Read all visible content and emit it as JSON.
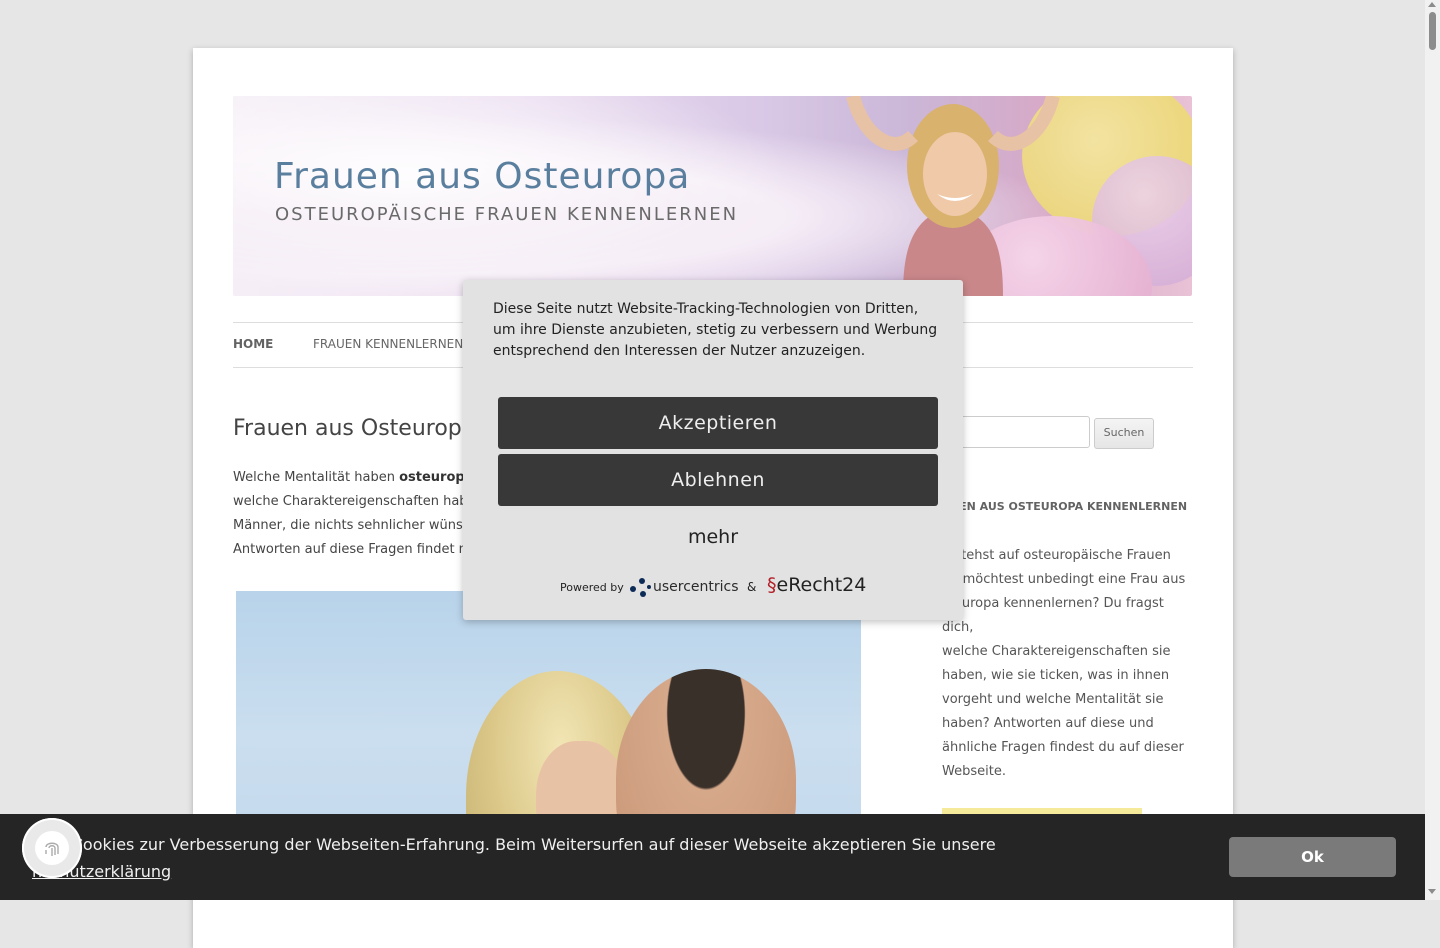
{
  "header": {
    "title": "Frauen aus Osteuropa",
    "subtitle": "OSTEUROPÄISCHE FRAUEN KENNENLERNEN"
  },
  "nav": {
    "items": [
      "HOME",
      "FRAUEN KENNENLERNEN"
    ]
  },
  "main": {
    "title": "Frauen aus Osteuropa",
    "intro_lines": [
      "Welche Mentalität haben ",
      "osteurop",
      "welche Charaktereigenschaften hab",
      "Männer, die nichts sehnlicher wüns",
      "Antworten auf diese Fragen findet n"
    ]
  },
  "sidebar": {
    "search_button": "Suchen",
    "widget_title": "AUEN AUS OSTEUROPA KENNENLERNEN",
    "widget_lines": [
      "u stehst auf osteuropäische Frauen",
      "nd möchtest unbedingt eine Frau aus",
      "steuropa kennenlernen? Du fragst dich,",
      "welche Charaktereigenschaften sie",
      "haben, wie sie ticken, was in ihnen",
      "vorgeht und welche Mentalität sie",
      "haben? Antworten auf diese und",
      "ähnliche Fragen findest du auf dieser",
      "Webseite."
    ]
  },
  "consent": {
    "message": "Diese Seite nutzt Website-Tracking-Technologien von Dritten, um ihre Dienste anzubieten, stetig zu verbessern und Werbung entsprechend den Interessen der Nutzer anzuzeigen.",
    "accept": "Akzeptieren",
    "deny": "Ablehnen",
    "more": "mehr",
    "powered_by": "Powered by",
    "usercentrics": "usercentrics",
    "amp": "&",
    "erecht": "eRecht24"
  },
  "cookiebar": {
    "text": "tzen Cookies zur Verbesserung der Webseiten-Erfahrung. Beim Weitersurfen auf dieser Webseite akzeptieren Sie unsere",
    "link": "nschutzerklärung",
    "ok": "Ok"
  },
  "colors": {
    "title_blue": "#5a7f9e",
    "modal_bg": "#e2e2e2",
    "modal_btn": "#383838",
    "cookiebar_bg": "#252525",
    "ok_btn": "#7a7a7a"
  },
  "icons": {
    "privacy_button": "fingerprint-icon"
  }
}
